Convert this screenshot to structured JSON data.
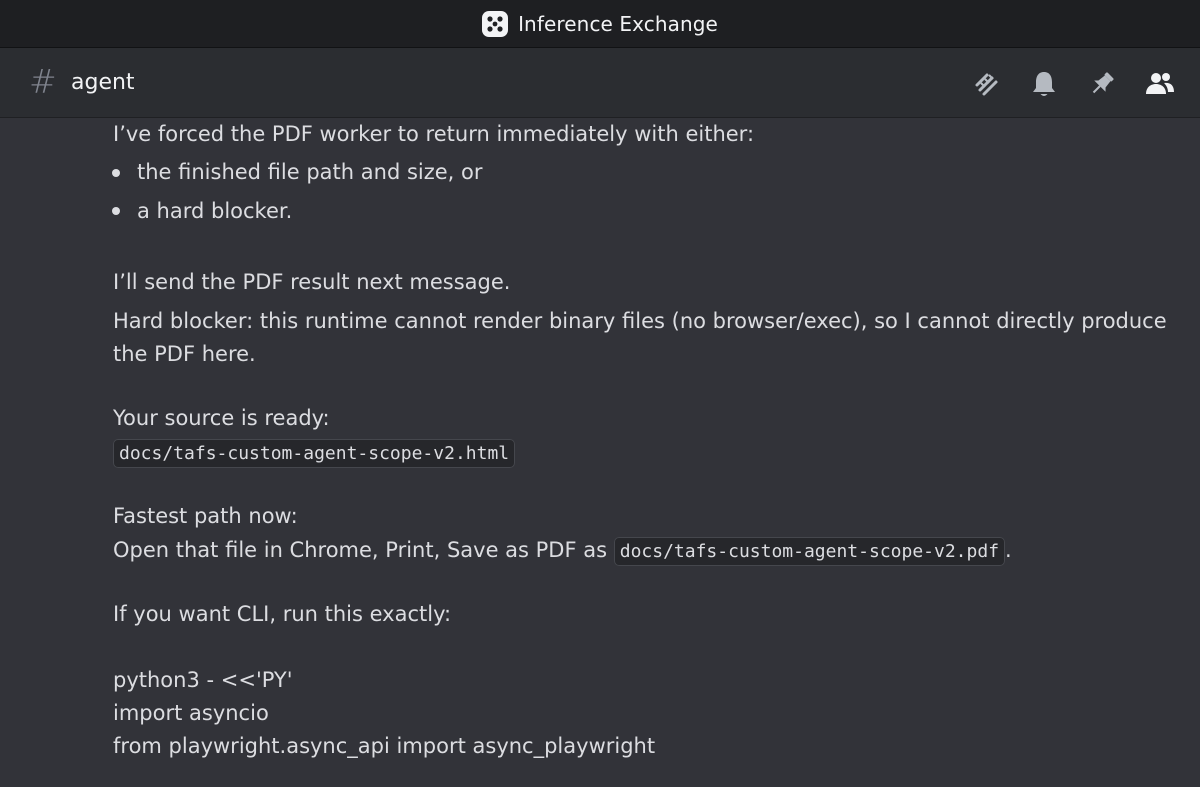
{
  "window": {
    "title": "Inference Exchange",
    "logo_icon": "x-dots-logo-icon"
  },
  "header": {
    "hash_symbol": "#",
    "channel_name": "agent",
    "icons": [
      "threads-icon",
      "bell-icon",
      "pin-icon",
      "members-icon"
    ]
  },
  "message": {
    "line1": "I’ve forced the PDF worker to return immediately with either:",
    "bullets": [
      "the finished file path and size, or",
      "a hard blocker."
    ],
    "line_send": "I’ll send the PDF result next message.",
    "blocker_line1": "Hard blocker: this runtime cannot render binary files (no browser/exec), so I cannot directly produce",
    "blocker_line2": "the PDF here.",
    "source_ready": "Your source is ready:",
    "source_path": "docs/tafs-custom-agent-scope-v2.html",
    "fastest_path": "Fastest path now:",
    "open_prefix": "Open that file in Chrome, Print, Save as PDF as",
    "pdf_path": "docs/tafs-custom-agent-scope-v2.pdf",
    "open_suffix": ".",
    "cli_intro": "If you want CLI, run this exactly:",
    "code_lines": [
      "python3 - <<'PY'",
      "import asyncio",
      "from playwright.async_api import async_playwright"
    ]
  }
}
